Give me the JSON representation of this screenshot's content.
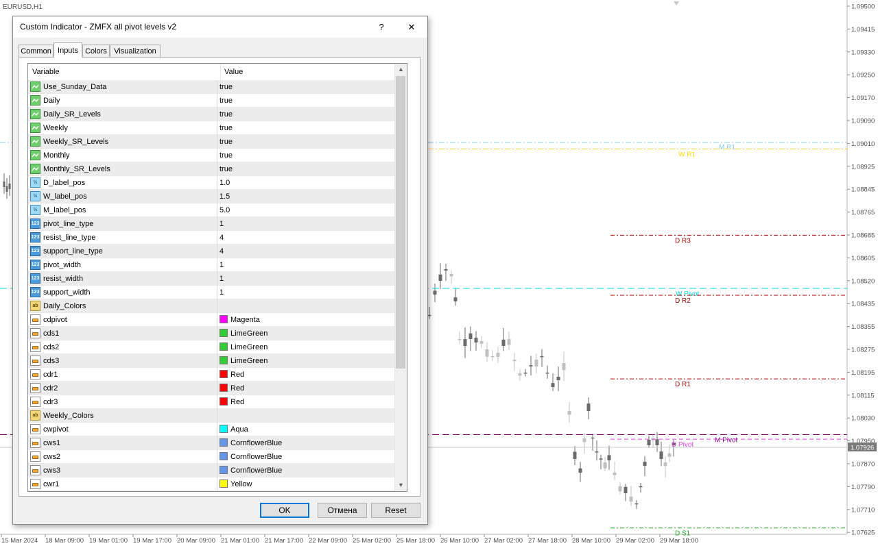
{
  "chart": {
    "symbol_label": "EURUSD,H1",
    "current_price": "1.07926",
    "price_axis": [
      "1.09500",
      "1.09415",
      "1.09330",
      "1.09250",
      "1.09170",
      "1.09090",
      "1.09010",
      "1.08925",
      "1.08845",
      "1.08765",
      "1.08685",
      "1.08605",
      "1.08520",
      "1.08435",
      "1.08355",
      "1.08275",
      "1.08195",
      "1.08115",
      "1.08030",
      "1.07950",
      "1.07870",
      "1.07790",
      "1.07710",
      "1.07625"
    ],
    "time_axis": [
      "15 Mar 2024",
      "18 Mar 09:00",
      "19 Mar 01:00",
      "19 Mar 17:00",
      "20 Mar 09:00",
      "21 Mar 01:00",
      "21 Mar 17:00",
      "22 Mar 09:00",
      "25 Mar 02:00",
      "25 Mar 18:00",
      "26 Mar 10:00",
      "27 Mar 02:00",
      "27 Mar 18:00",
      "28 Mar 10:00",
      "29 Mar 02:00",
      "29 Mar 18:00"
    ],
    "levels": [
      {
        "label": "M R1",
        "price": 1.09018,
        "color": "#87ceeb"
      },
      {
        "label": "W R1",
        "price": 1.08995,
        "color": "#ffd800"
      },
      {
        "label": "D R3",
        "price": 1.0869,
        "color": "#b00000"
      },
      {
        "label": "W Pivot",
        "price": 1.08502,
        "color": "#00d8d8"
      },
      {
        "label": "D R2",
        "price": 1.08478,
        "color": "#b00000"
      },
      {
        "label": "D R1",
        "price": 1.08182,
        "color": "#b00000"
      },
      {
        "label": "M Pivot",
        "price": 1.07985,
        "color": "#800080"
      },
      {
        "label": "D Pivot",
        "price": 1.07969,
        "color": "#e040e0"
      },
      {
        "label": "D S1",
        "price": 1.07655,
        "color": "#22aa22"
      }
    ]
  },
  "dialog": {
    "title": "Custom Indicator - ZMFX all pivot levels v2",
    "help_label": "?",
    "close_label": "✕",
    "tabs": [
      "Common",
      "Inputs",
      "Colors",
      "Visualization"
    ],
    "active_tab": "Inputs",
    "col_variable": "Variable",
    "col_value": "Value",
    "rows": [
      {
        "type": "bool",
        "name": "Use_Sunday_Data",
        "value": "true"
      },
      {
        "type": "bool",
        "name": "Daily",
        "value": "true"
      },
      {
        "type": "bool",
        "name": "Daily_SR_Levels",
        "value": "true"
      },
      {
        "type": "bool",
        "name": "Weekly",
        "value": "true"
      },
      {
        "type": "bool",
        "name": "Weekly_SR_Levels",
        "value": "true"
      },
      {
        "type": "bool",
        "name": "Monthly",
        "value": "true"
      },
      {
        "type": "bool",
        "name": "Monthly_SR_Levels",
        "value": "true"
      },
      {
        "type": "double",
        "name": "D_label_pos",
        "value": "1.0"
      },
      {
        "type": "double",
        "name": "W_label_pos",
        "value": "1.5"
      },
      {
        "type": "double",
        "name": "M_label_pos",
        "value": "5.0"
      },
      {
        "type": "int",
        "name": "pivot_line_type",
        "value": "1"
      },
      {
        "type": "int",
        "name": "resist_line_type",
        "value": "4"
      },
      {
        "type": "int",
        "name": "support_line_type",
        "value": "4"
      },
      {
        "type": "int",
        "name": "pivot_width",
        "value": "1"
      },
      {
        "type": "int",
        "name": "resist_width",
        "value": "1"
      },
      {
        "type": "int",
        "name": "support_width",
        "value": "1"
      },
      {
        "type": "string",
        "name": "Daily_Colors",
        "value": ""
      },
      {
        "type": "color",
        "name": "cdpivot",
        "value": "Magenta",
        "swatch": "#ff00ff"
      },
      {
        "type": "color",
        "name": "cds1",
        "value": "LimeGreen",
        "swatch": "#32cd32"
      },
      {
        "type": "color",
        "name": "cds2",
        "value": "LimeGreen",
        "swatch": "#32cd32"
      },
      {
        "type": "color",
        "name": "cds3",
        "value": "LimeGreen",
        "swatch": "#32cd32"
      },
      {
        "type": "color",
        "name": "cdr1",
        "value": "Red",
        "swatch": "#ff0000"
      },
      {
        "type": "color",
        "name": "cdr2",
        "value": "Red",
        "swatch": "#ff0000"
      },
      {
        "type": "color",
        "name": "cdr3",
        "value": "Red",
        "swatch": "#ff0000"
      },
      {
        "type": "string",
        "name": "Weekly_Colors",
        "value": ""
      },
      {
        "type": "color",
        "name": "cwpivot",
        "value": "Aqua",
        "swatch": "#00ffff"
      },
      {
        "type": "color",
        "name": "cws1",
        "value": "CornflowerBlue",
        "swatch": "#6495ed"
      },
      {
        "type": "color",
        "name": "cws2",
        "value": "CornflowerBlue",
        "swatch": "#6495ed"
      },
      {
        "type": "color",
        "name": "cws3",
        "value": "CornflowerBlue",
        "swatch": "#6495ed"
      },
      {
        "type": "color",
        "name": "cwr1",
        "value": "Yellow",
        "swatch": "#ffff00"
      }
    ],
    "buttons": {
      "ok": "OK",
      "cancel": "Отмена",
      "reset": "Reset"
    }
  }
}
